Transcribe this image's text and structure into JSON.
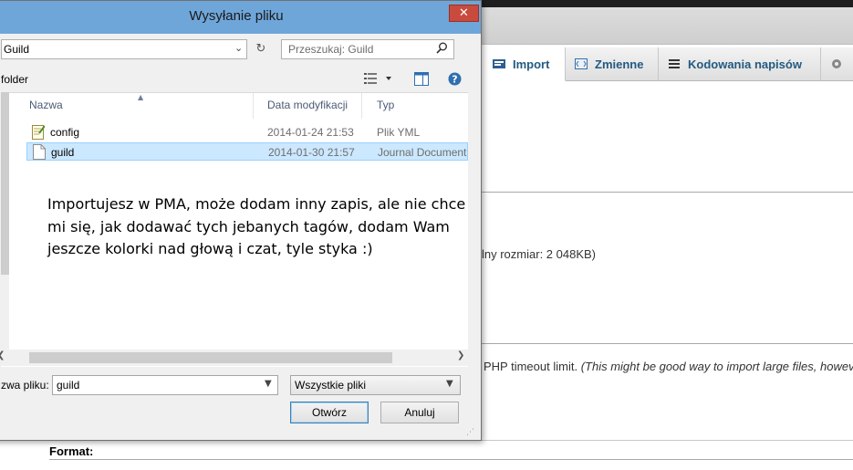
{
  "background": {
    "tabs": [
      {
        "label": "Import",
        "icon": "import-icon"
      },
      {
        "label": "Zmienne",
        "icon": "variables-icon"
      },
      {
        "label": "Kodowania napisów",
        "icon": "charset-icon"
      }
    ],
    "max_size_text": "lny rozmiar: 2 048KB)",
    "timeout_text": "PHP timeout limit.",
    "timeout_text_italic": "(This might be good way to import large files, howev",
    "format_label": "Format:"
  },
  "dialog": {
    "title": "Wysyłanie pliku",
    "close_symbol": "✕",
    "address": "Guild",
    "search_placeholder": "Przeszukaj: Guild",
    "new_folder_label": "folder",
    "columns": {
      "name": "Nazwa",
      "date": "Data modyfikacji",
      "type": "Typ"
    },
    "files": [
      {
        "name": "config",
        "date": "2014-01-24 21:53",
        "type": "Plik YML",
        "icon": "yml-file-icon",
        "selected": false
      },
      {
        "name": "guild",
        "date": "2014-01-30 21:57",
        "type": "Journal Document",
        "icon": "document-file-icon",
        "selected": true
      }
    ],
    "filename_label": "zwa pliku:",
    "filename_value": "guild",
    "filter_value": "Wszystkie pliki",
    "open_button": "Otwórz",
    "cancel_button": "Anuluj"
  },
  "note": "Importujesz w PMA, może dodam inny zapis, ale nie chce\nmi się, jak dodawać tych jebanych tagów, dodam Wam\njeszcze kolorki nad głową i czat, tyle styka :)"
}
